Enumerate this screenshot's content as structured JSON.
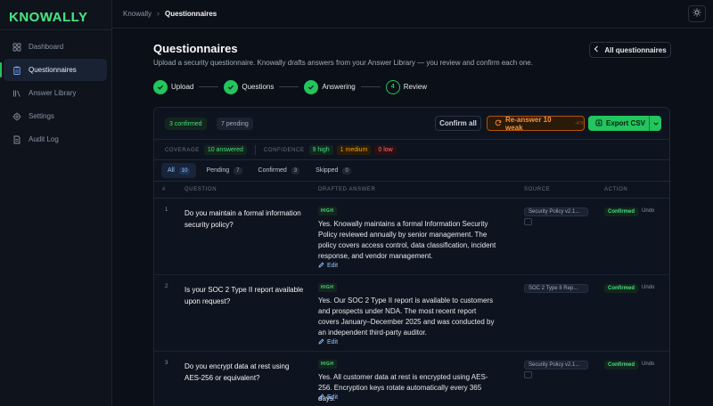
{
  "app": {
    "logo": "KNOWALLY"
  },
  "sidebar": {
    "items": [
      {
        "label": "Dashboard",
        "icon": "grid-icon"
      },
      {
        "label": "Questionnaires",
        "icon": "clipboard-icon"
      },
      {
        "label": "Answer Library",
        "icon": "library-icon"
      },
      {
        "label": "Settings",
        "icon": "gear-icon"
      },
      {
        "label": "Audit Log",
        "icon": "log-icon"
      }
    ],
    "active": "Questionnaires"
  },
  "breadcrumb": {
    "root": "Knowally",
    "sep": "›",
    "current": "Questionnaires"
  },
  "page": {
    "title": "Questionnaires",
    "subtitle": "Upload a security questionnaire. Knowally drafts answers from your Answer Library — you review and confirm each one.",
    "all_button": "All questionnaires"
  },
  "steps": [
    {
      "label": "Upload",
      "state": "done"
    },
    {
      "label": "Questions",
      "state": "done"
    },
    {
      "label": "Answering",
      "state": "done"
    },
    {
      "label": "Review",
      "state": "current",
      "num": "4"
    }
  ],
  "toolbar": {
    "confirmed_pill": "3 confirmed",
    "pending_pill": "7 pending",
    "confirm_all": "Confirm all",
    "reanswer": "Re-answer 10 weak",
    "reanswer_cost": "-47¢",
    "export": "Export CSV"
  },
  "metrics": {
    "coverage_label": "COVERAGE",
    "coverage_value": "10 answered",
    "confidence_label": "CONFIDENCE",
    "high": "9 high",
    "medium": "1 medium",
    "low": "0 low"
  },
  "tabs": [
    {
      "label": "All",
      "count": "10"
    },
    {
      "label": "Pending",
      "count": "7"
    },
    {
      "label": "Confirmed",
      "count": "3"
    },
    {
      "label": "Skipped",
      "count": "0"
    }
  ],
  "table": {
    "headers": {
      "num": "#",
      "question": "QUESTION",
      "answer": "DRAFTED ANSWER",
      "source": "SOURCE",
      "action": "ACTION"
    },
    "rows": [
      {
        "num": "1",
        "question": "Do you maintain a formal information security policy?",
        "confidence": "HIGH",
        "answer": "Yes. Knowally maintains a formal Information Security Policy reviewed annually by senior management. The policy covers access control, data classification, incident response, and vendor management.",
        "edit": "Edit",
        "source": "Security Policy v2.1...",
        "status": "Confirmed",
        "undo": "Undo"
      },
      {
        "num": "2",
        "question": "Is your SOC 2 Type II report available upon request?",
        "confidence": "HIGH",
        "answer": "Yes. Our SOC 2 Type II report is available to customers and prospects under NDA. The most recent report covers January–December 2025 and was conducted by an independent third-party auditor.",
        "edit": "Edit",
        "source": "SOC 2 Type II Rep...",
        "status": "Confirmed",
        "undo": "Undo"
      },
      {
        "num": "3",
        "question": "Do you encrypt data at rest using AES-256 or equivalent?",
        "confidence": "HIGH",
        "answer": "Yes. All customer data at rest is encrypted using AES-256. Encryption keys rotate automatically every 365 days.",
        "edit": "Edit",
        "source": "Security Policy v2.1...",
        "status": "Confirmed",
        "undo": "Undo"
      }
    ]
  },
  "colors": {
    "accent": "#22c55e",
    "warning": "#f59e0b",
    "danger": "#f87171",
    "link": "#93c5fd"
  }
}
